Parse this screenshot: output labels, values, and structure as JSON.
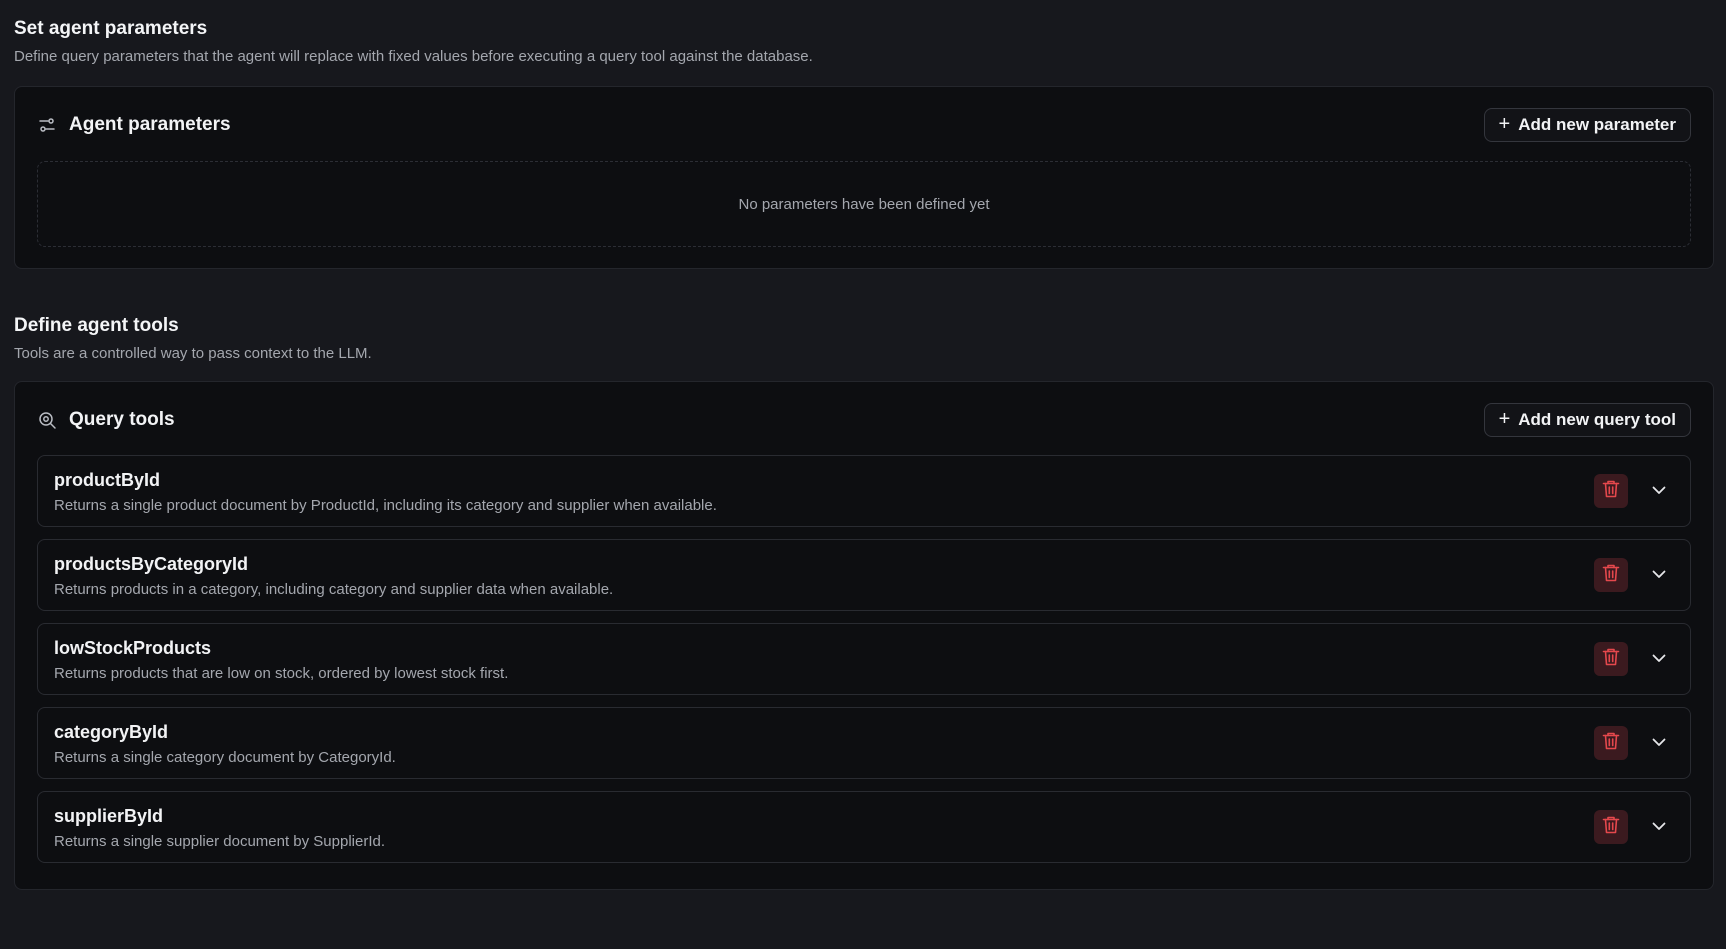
{
  "parameters_section": {
    "title": "Set agent parameters",
    "description": "Define query parameters that the agent will replace with fixed values before executing a query tool against the database.",
    "card": {
      "icon": "sliders-icon",
      "title": "Agent parameters",
      "add_button_label": "Add new parameter",
      "empty_message": "No parameters have been defined yet"
    }
  },
  "tools_section": {
    "title": "Define agent tools",
    "description": "Tools are a controlled way to pass context to the LLM.",
    "card": {
      "icon": "search-zoom-icon",
      "title": "Query tools",
      "add_button_label": "Add new query tool"
    },
    "tools": [
      {
        "name": "productById",
        "description": "Returns a single product document by ProductId, including its category and supplier when available."
      },
      {
        "name": "productsByCategoryId",
        "description": "Returns products in a category, including category and supplier data when available."
      },
      {
        "name": "lowStockProducts",
        "description": "Returns products that are low on stock, ordered by lowest stock first."
      },
      {
        "name": "categoryById",
        "description": "Returns a single category document by CategoryId."
      },
      {
        "name": "supplierById",
        "description": "Returns a single supplier document by SupplierId."
      }
    ]
  },
  "colors": {
    "background": "#17181d",
    "card": "#0d0e11",
    "danger_bg": "#3b1a1f",
    "danger_icon": "#e5484d"
  }
}
